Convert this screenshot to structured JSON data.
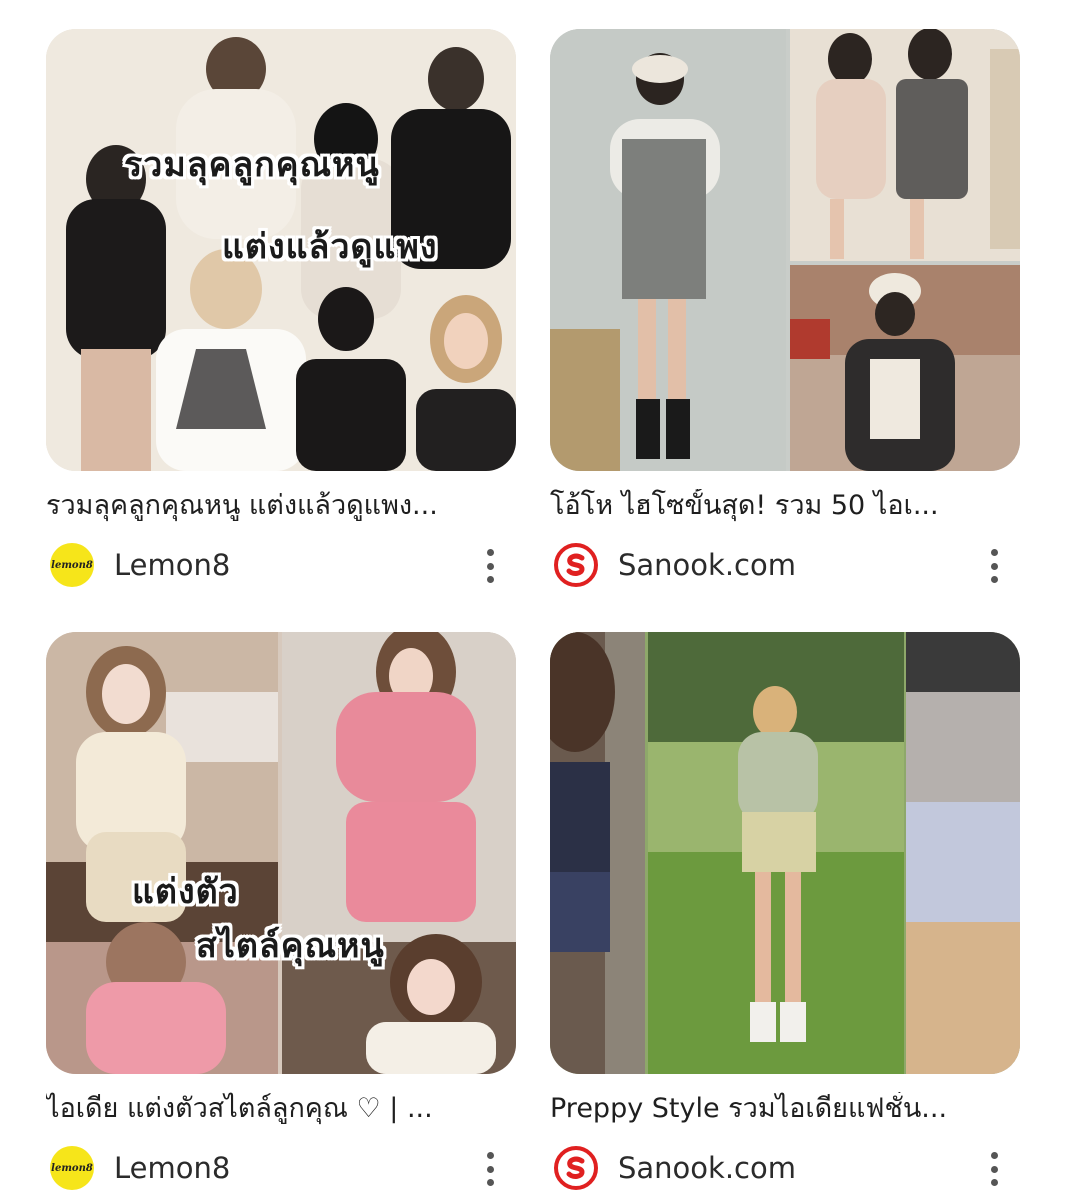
{
  "results": [
    {
      "title": "รวมลุคลูกคุณหนู แต่งแล้วดูแพง...",
      "source": "Lemon8",
      "logo_text": "lemon8",
      "overlay_line1": "รวมลุคลูกคุณหนู",
      "overlay_line2": "แต่งแล้วดูแพง"
    },
    {
      "title": "โอ้โห ไฮโซขั้นสุด! รวม 50 ไอเ...",
      "source": "Sanook.com"
    },
    {
      "title": "ไอเดีย แต่งตัวสไตล์ลูกคุณ ♡ | ...",
      "source": "Lemon8",
      "logo_text": "lemon8",
      "overlay_line1": "แต่งตัว",
      "overlay_line2": "สไตล์คุณหนู"
    },
    {
      "title": "Preppy Style รวมไอเดียแฟชั่น...",
      "source": "Sanook.com"
    }
  ],
  "colors": {
    "lemon8_logo": "#f6e51a",
    "sanook_logo": "#e02020"
  }
}
